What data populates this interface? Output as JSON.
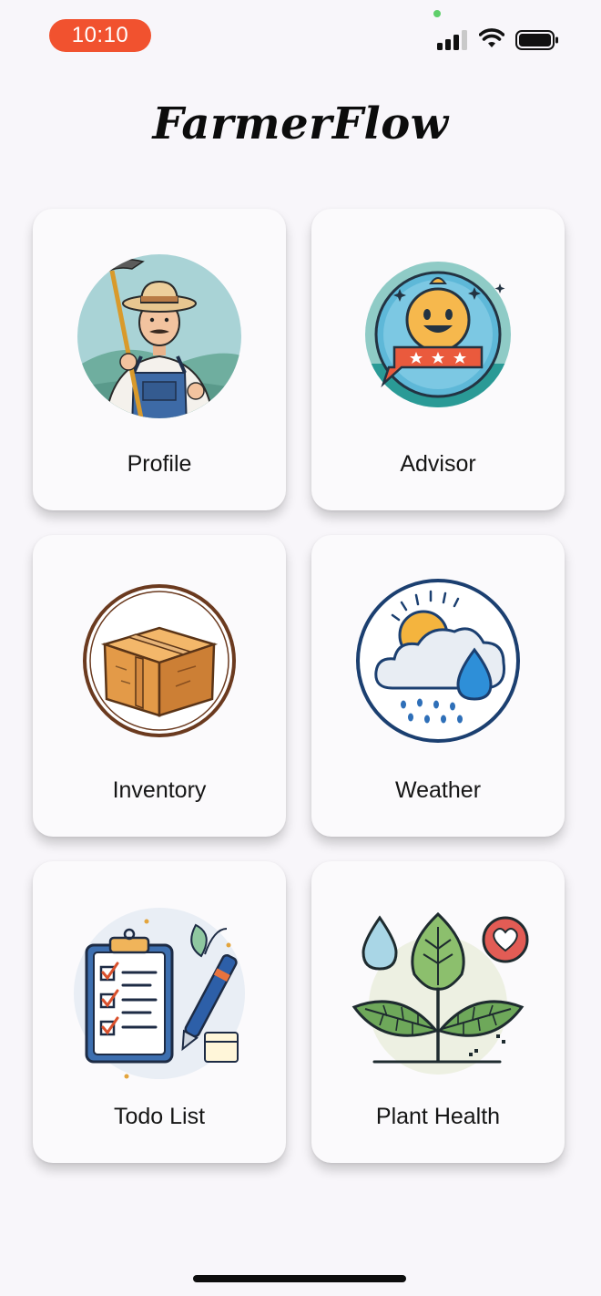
{
  "status_bar": {
    "time": "10:10",
    "time_pill_color": "#f1522f",
    "signal_bars": 4,
    "signal_bars_filled": 3,
    "icons": [
      "cellular-signal-icon",
      "wifi-icon",
      "battery-icon"
    ]
  },
  "app": {
    "title": "FarmerFlow"
  },
  "menu": {
    "items": [
      {
        "label": "Profile",
        "icon": "farmer-icon"
      },
      {
        "label": "Advisor",
        "icon": "advisor-chatbot-icon"
      },
      {
        "label": "Inventory",
        "icon": "box-icon"
      },
      {
        "label": "Weather",
        "icon": "rain-cloud-icon"
      },
      {
        "label": "Todo List",
        "icon": "checklist-clipboard-icon"
      },
      {
        "label": "Plant Health",
        "icon": "plant-health-icon"
      }
    ]
  }
}
